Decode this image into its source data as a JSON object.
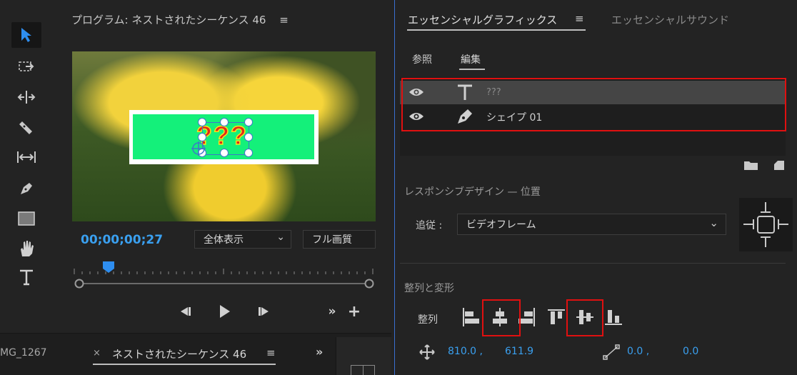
{
  "program_monitor": {
    "title": "プログラム: ネストされたシーケンス 46",
    "menu_icon": "≡",
    "overlay_text": "???",
    "timecode": "00;00;00;27",
    "zoom_value": "全体表示",
    "quality_value": "フル画質"
  },
  "project_panel": {
    "tab_partial": "MG_1267",
    "close_icon": "×",
    "active_tab": "ネストされたシーケンス 46",
    "menu_icon": "≡",
    "more_icon": "»"
  },
  "essential_graphics": {
    "title": "エッセンシャルグラフィックス",
    "menu_icon": "≡",
    "sound_tab": "エッセンシャルサウンド",
    "tabs": {
      "browse": "参照",
      "edit": "編集"
    },
    "layers": [
      {
        "name": "???",
        "type_icon": "text-layer-icon"
      },
      {
        "name": "シェイプ 01",
        "type_icon": "pen-layer-icon"
      }
    ],
    "responsive_design_label": "レスポンシブデザイン — 位置",
    "follow_label": "追従 :",
    "follow_value": "ビデオフレーム",
    "align_transform_label": "整列と変形",
    "align_label": "整列",
    "position": {
      "x": "810.0 ,",
      "y": "611.9"
    },
    "anchor": {
      "x": "0.0 ,",
      "y": "0.0"
    }
  },
  "colors": {
    "accent_blue": "#3aa0f0",
    "highlight_red": "#e01010",
    "shape_green": "#14f07a"
  }
}
